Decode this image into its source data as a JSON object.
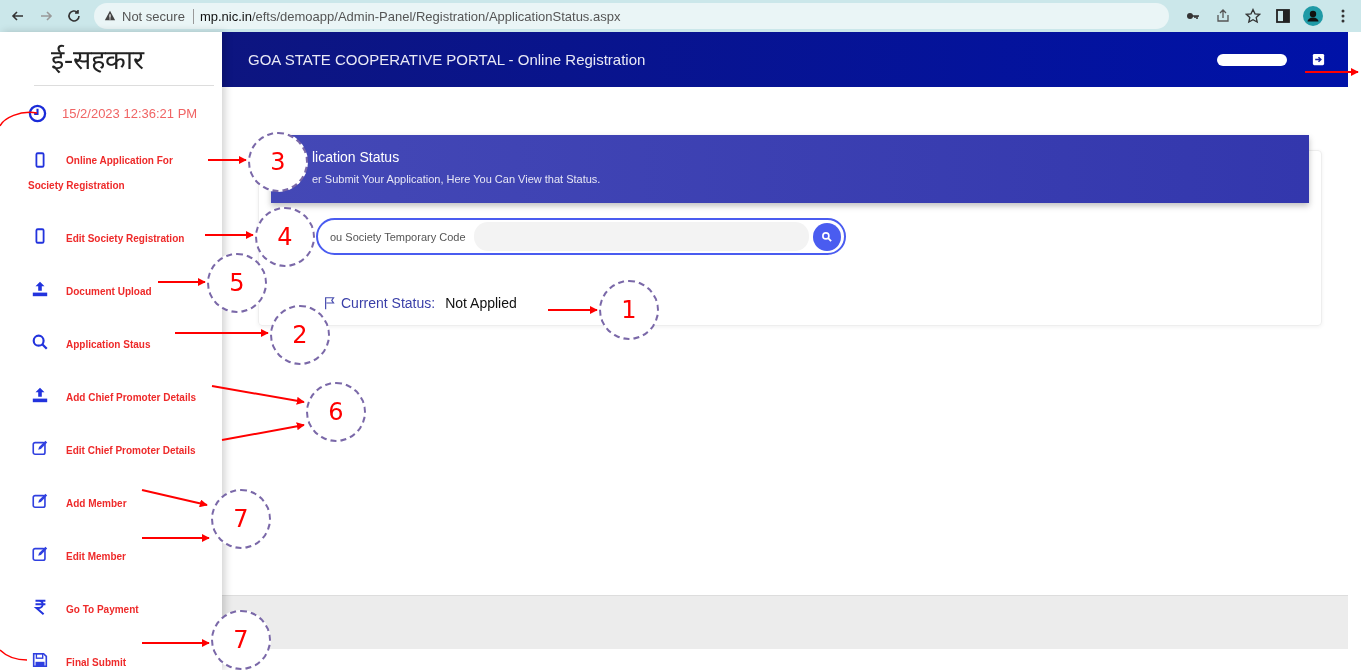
{
  "browser": {
    "security": "Not secure",
    "url_host": "mp.nic.in",
    "url_path": "/efts/demoapp/Admin-Panel/Registration/ApplicationStatus.aspx"
  },
  "sidebar": {
    "logo": "ई-सहकार",
    "datetime": "15/2/2023 12:36:21 PM",
    "items": [
      {
        "label": "Online Application For Society Registration",
        "kind": "phone"
      },
      {
        "label": "Edit Society Registration",
        "kind": "phone"
      },
      {
        "label": "Document Upload",
        "kind": "upload"
      },
      {
        "label": "Application Staus",
        "kind": "search"
      },
      {
        "label": "Add Chief Promoter Details",
        "kind": "upload"
      },
      {
        "label": "Edit Chief Promoter Details",
        "kind": "edit"
      },
      {
        "label": "Add Member",
        "kind": "edit"
      },
      {
        "label": "Edit Member",
        "kind": "edit"
      },
      {
        "label": "Go To Payment",
        "kind": "rupee"
      },
      {
        "label": "Final Submit",
        "kind": "save"
      }
    ]
  },
  "header": {
    "title": "GOA STATE COOPERATIVE PORTAL - Online Registration"
  },
  "banner": {
    "title": "lication Status",
    "subtitle": "er Submit Your Application, Here You Can View that Status."
  },
  "search": {
    "label": "ou Society Temporary Code"
  },
  "status": {
    "label": "Current Status:",
    "value": "Not Applied"
  },
  "annotations": [
    {
      "label": "3"
    },
    {
      "label": "4"
    },
    {
      "label": "5"
    },
    {
      "label": "2"
    },
    {
      "label": "6"
    },
    {
      "label": "7"
    },
    {
      "label": "7"
    },
    {
      "label": "1"
    }
  ]
}
